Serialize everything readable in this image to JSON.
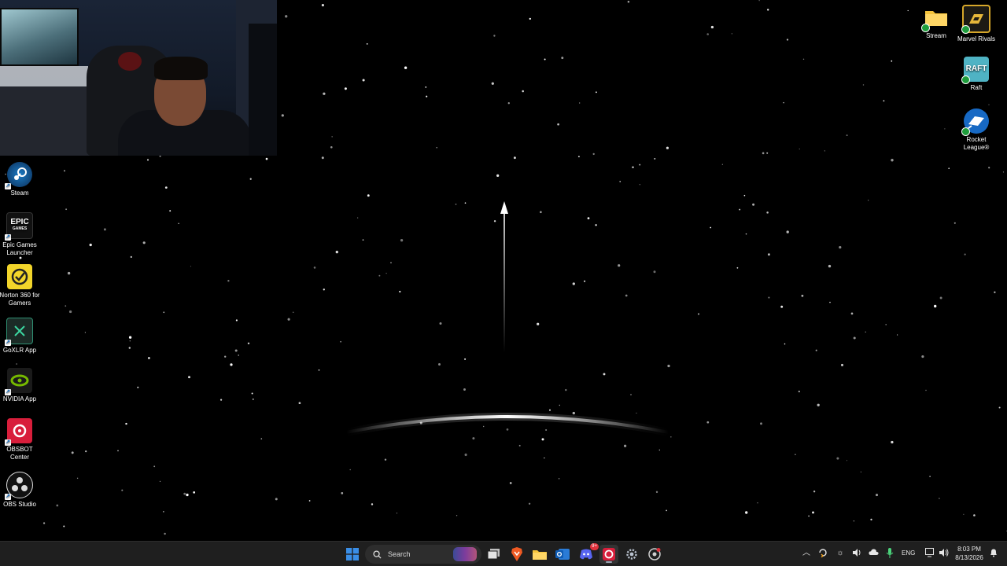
{
  "desktop": {
    "left_icons": [
      {
        "label": "Steam",
        "icon": "steam-icon"
      },
      {
        "label": "Epic Games Launcher",
        "icon": "epic-games-icon",
        "glyph": "EPIC",
        "subglyph": "GAMES"
      },
      {
        "label": "Norton 360 for Gamers",
        "icon": "norton-icon"
      },
      {
        "label": "GoXLR App",
        "icon": "goxlr-icon"
      },
      {
        "label": "NVIDIA App",
        "icon": "nvidia-icon"
      },
      {
        "label": "OBSBOT Center",
        "icon": "obsbot-icon"
      },
      {
        "label": "OBS Studio",
        "icon": "obs-studio-icon"
      }
    ],
    "right_icons": [
      {
        "label": "Stream",
        "icon": "folder-icon"
      },
      {
        "label": "Marvel Rivals",
        "icon": "marvel-rivals-icon"
      },
      {
        "label": "Raft",
        "icon": "raft-icon",
        "glyph": "RAFT"
      },
      {
        "label": "Rocket League®",
        "icon": "rocket-league-icon"
      }
    ]
  },
  "taskbar": {
    "search_placeholder": "Search",
    "pinned": [
      "windows-start-icon",
      "search-icon",
      "task-view-icon",
      "brave-browser-icon",
      "file-explorer-icon",
      "outlook-icon",
      "discord-icon",
      "obsbot-taskbar-icon",
      "settings-icon",
      "chrome-like-icon"
    ],
    "discord_badge": "9+",
    "language": "ENG",
    "time": "8:03 PM",
    "date": "8/13/2026",
    "colors": {
      "taskbar": "#1f1f1f",
      "accent": "#3a8ee6",
      "obsbot_red": "#d81e3b",
      "brave_orange": "#f05a23",
      "folder_yellow": "#f5c33b"
    }
  }
}
